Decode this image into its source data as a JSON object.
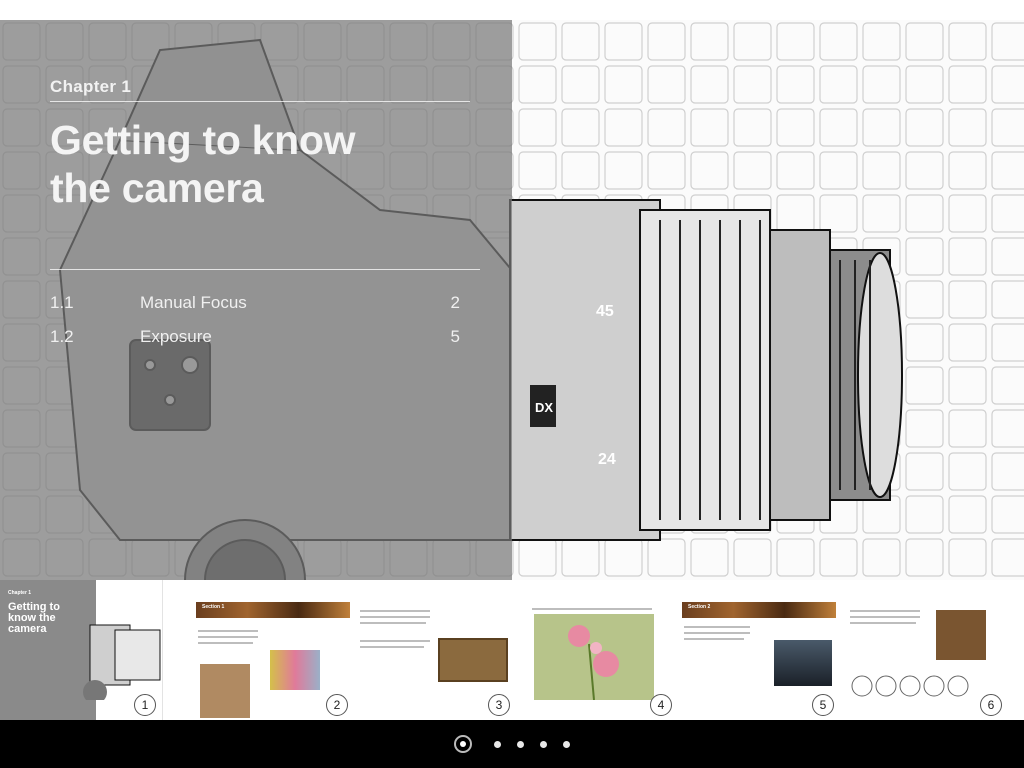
{
  "chapter": {
    "label": "Chapter 1",
    "title_line1": "Getting to know",
    "title_line2": "the camera"
  },
  "toc": [
    {
      "num": "1.1",
      "title": "Manual Focus",
      "page": "2"
    },
    {
      "num": "1.2",
      "title": "Exposure",
      "page": "5"
    }
  ],
  "lens_markings": {
    "focal_a": "45",
    "focal_b": "24",
    "badge": "DX"
  },
  "thumbnails": [
    {
      "number": "1",
      "title": "Getting to know the camera",
      "chapter": "Chapter 1"
    },
    {
      "number": "2",
      "section": "Section 1"
    },
    {
      "number": "3"
    },
    {
      "number": "4"
    },
    {
      "number": "5",
      "section": "Section 2"
    },
    {
      "number": "6"
    }
  ],
  "page_dots": {
    "count": 5,
    "active": 1
  },
  "colors": {
    "panel_gray": "#787878",
    "page_bg": "#fbfbfb",
    "dock": "#000000"
  }
}
